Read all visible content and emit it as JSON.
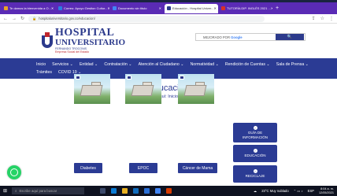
{
  "browser": {
    "tabs": [
      {
        "label": "Te damos la bienvenida a O...",
        "active": false
      },
      {
        "label": "Correo: Apoyo Gestion Cultur...",
        "active": false
      },
      {
        "label": "Documento sin título",
        "active": false
      },
      {
        "label": "Educación - Hospital Univer...",
        "active": true
      },
      {
        "label": "TUTORÍA DIP. INGLÉS 2021 ...",
        "active": false
      }
    ],
    "url": "hospitaluniversitario.gov.co/educacion/"
  },
  "header": {
    "logo": {
      "line1": "HOSPITAL",
      "line2": "UNIVERSITARIO",
      "line3": "FERNANDO TROCONIS",
      "line4": "Empresa Social del Estado"
    },
    "search_placeholder": "MEJORADO POR",
    "search_brand": "Google",
    "search_button": "🔍"
  },
  "menu": {
    "row1": [
      "Inicio",
      "Servicios ⌄",
      "Entidad ⌄",
      "Contratación ⌄",
      "Atención al Ciudadano ⌄",
      "Normatividad ⌄",
      "Rendición de Cuentas ⌄",
      "Sala de Prensa ⌄"
    ],
    "row2": [
      "Trámites",
      "COVID 19 ⌄"
    ]
  },
  "main": {
    "title": "Educación",
    "breadcrumb": "Usted esta aquí: Inicio / Educación",
    "cards": [
      {
        "label": "Diabetes"
      },
      {
        "label": "EPOC"
      },
      {
        "label": "Cáncer de Mama"
      }
    ],
    "side_buttons": [
      {
        "line1": "GUÍA DE",
        "line2": "INFORMACIÓN"
      },
      {
        "line1": "EDUCACIÓN",
        "line2": ""
      },
      {
        "line1": "RECICLAJE",
        "line2": ""
      }
    ]
  },
  "taskbar": {
    "search_placeholder": "Escribe aquí para buscar",
    "weather": "23°C Muy nublado",
    "lang": "ESP",
    "time": "8:04 a. m.",
    "date": "12/05/2021"
  },
  "colors": {
    "brand_blue": "#2b3b94",
    "brand_red": "#c0272d",
    "chrome_tab_bar": "#5a2bb5",
    "whatsapp": "#25d366"
  }
}
